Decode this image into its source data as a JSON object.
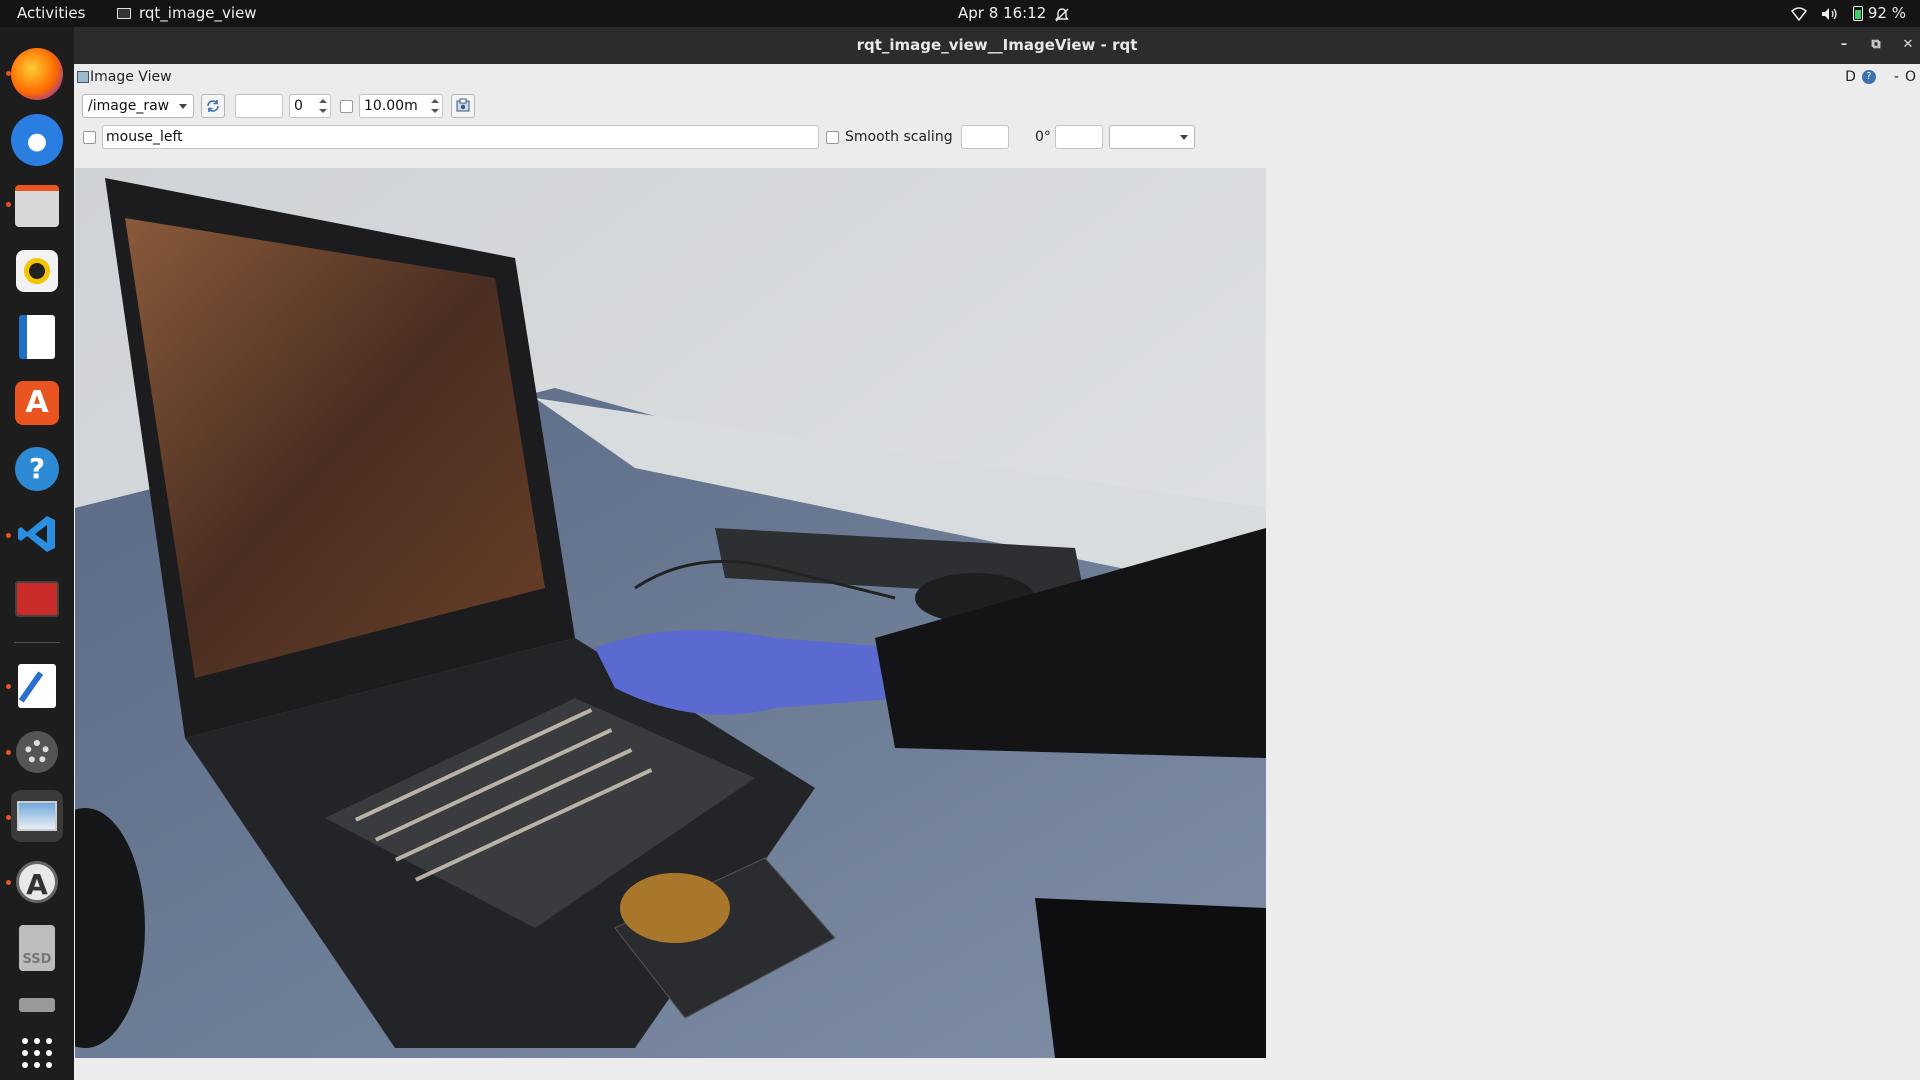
{
  "topbar": {
    "activities": "Activities",
    "app_name": "rqt_image_view",
    "clock": "Apr 8  16:12",
    "battery": "92 %"
  },
  "window": {
    "title": "rqt_image_view__ImageView - rqt"
  },
  "plugin": {
    "title": "Image View",
    "right_label_d": "D",
    "right_label_dash": "-",
    "right_label_o": "O"
  },
  "toolbar": {
    "topic": "/image_raw",
    "number_value": "0",
    "max_value": "10.00m",
    "mouse_topic": "mouse_left",
    "smooth_scaling_label": "Smooth scaling",
    "rotation_label": "0°"
  },
  "dock": {
    "apps": [
      "firefox-icon",
      "thunderbird-icon",
      "files-icon",
      "rhythmbox-icon",
      "writer-icon",
      "app-center-icon",
      "help-icon",
      "vscode-icon",
      "terminal-icon",
      "text-editor-icon",
      "settings-icon",
      "image-viewer-icon",
      "software-updater-icon",
      "ssd-drive-icon",
      "show-apps-icon"
    ],
    "ssd_label": "SSD"
  },
  "colors": {
    "accent": "#e95420",
    "topbar": "#141414",
    "dock": "#1d1d1d",
    "titlebar": "#2c2c2c"
  }
}
